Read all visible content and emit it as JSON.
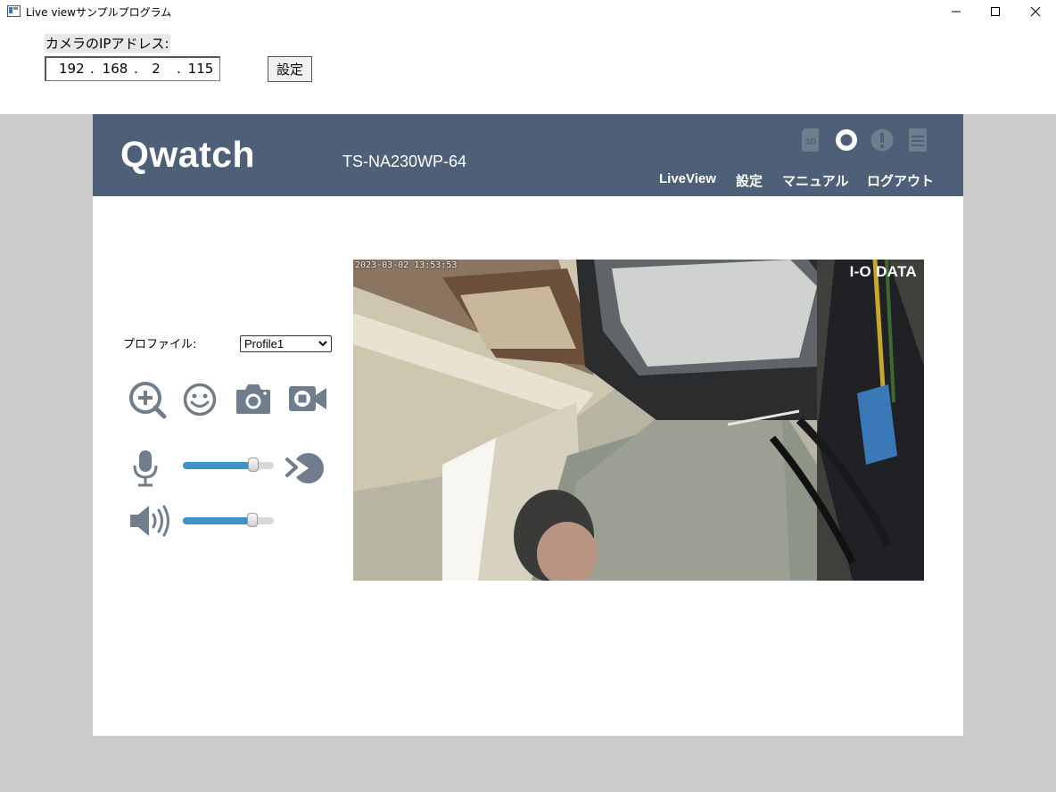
{
  "window": {
    "title": "Live viewサンプルプログラム"
  },
  "form": {
    "ip_label": "カメラのIPアドレス:",
    "ip_octets": [
      "192",
      "168",
      "2",
      "115"
    ],
    "ip_separator": ".",
    "set_button": "設定"
  },
  "camera_page": {
    "logo": "Qwatch",
    "model": "TS-NA230WP-64",
    "header_icons": [
      "sd-card-icon",
      "record-status-icon",
      "alert-icon",
      "menu-list-icon"
    ],
    "header_icon_text": {
      "sd": "SD"
    },
    "nav": [
      "LiveView",
      "設定",
      "マニュアル",
      "ログアウト"
    ],
    "profile": {
      "label": "プロファイル:",
      "selected": "Profile1"
    },
    "controls": [
      "zoom-in-icon",
      "face-detect-icon",
      "snapshot-icon",
      "record-video-icon"
    ],
    "mic_level": 0.77,
    "speaker_level": 0.76,
    "video": {
      "timestamp": "2023-03-02 13:53:53",
      "brand": "I-O DATA"
    },
    "colors": {
      "header_bg": "#4d6078",
      "icon_gray": "#6f7d8c",
      "slider_fill": "#3d95c4"
    }
  }
}
